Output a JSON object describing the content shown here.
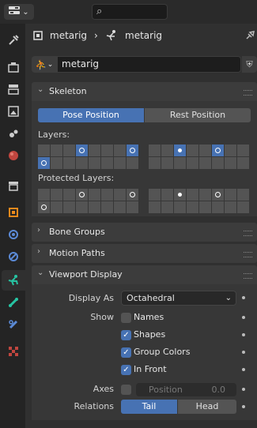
{
  "header": {
    "editor_icon": "properties-editor-icon",
    "search_icon": "⌕"
  },
  "breadcrumb": {
    "object": "metarig",
    "data": "metarig"
  },
  "datablock": {
    "name": "metarig"
  },
  "skeleton": {
    "title": "Skeleton",
    "pose_position": "Pose Position",
    "rest_position": "Rest Position",
    "active_position": "Pose Position",
    "layers_label": "Layers:",
    "protected_label": "Protected Layers:"
  },
  "panels": {
    "bone_groups": "Bone Groups",
    "motion_paths": "Motion Paths",
    "viewport_display": "Viewport Display"
  },
  "viewport_display": {
    "display_as_label": "Display As",
    "display_as_value": "Octahedral",
    "show_label": "Show",
    "names": "Names",
    "names_checked": false,
    "shapes": "Shapes",
    "shapes_checked": true,
    "group_colors": "Group Colors",
    "group_colors_checked": true,
    "in_front": "In Front",
    "in_front_checked": true,
    "axes_label": "Axes",
    "axes_checked": false,
    "position_label": "Position",
    "position_value": "0.0",
    "relations_label": "Relations",
    "tail": "Tail",
    "head": "Head",
    "relations_active": "Tail"
  },
  "colors": {
    "accent": "#4772b3",
    "panel": "#373737",
    "header": "#3c3c3c"
  }
}
